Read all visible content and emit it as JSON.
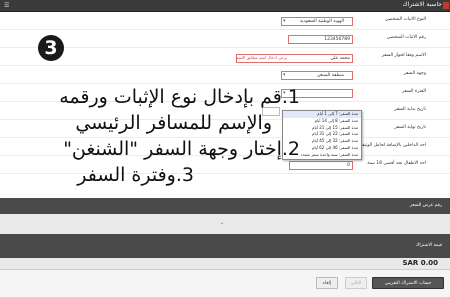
{
  "header": {
    "title": "حاسبة الاشتراك"
  },
  "form": {
    "fields": [
      {
        "label": "النوع الاثبات الشخصي",
        "value": "الهوية الوطنية السعودية"
      },
      {
        "label": "رقم الاثبات الشخصي",
        "value": "123456789"
      },
      {
        "label": "الاسم وفقا لجواز السفر",
        "value": "محمد علي",
        "hint": "يرجي ادخال اسم مطابق الاسم"
      },
      {
        "label": "وجهة السفر",
        "value": "منطقة الشنغن"
      },
      {
        "label": "الفترة السفر",
        "value": ""
      },
      {
        "label": "تاريخ بداية السفر",
        "value": ""
      },
      {
        "label": "تاريخ نهاية السفر",
        "value": ""
      },
      {
        "label": "احد الداخلين بالإضافة لحامل الوثيقة",
        "value": ""
      },
      {
        "label": "احد الاطفال بحد أقصى 18 سنة",
        "value": "0"
      }
    ],
    "period_options": [
      "مدة السفر: 7 إلى 1 أيام",
      "مدة السفر: 8 إلى 14 أيام",
      "مدة السفر: 15 إلى 21 أيام",
      "مدة السفر: 22 إلى 31 أيام",
      "مدة السفر: 32 إلى 45 أيام",
      "مدة السفر: 46 إلى 62 أيام",
      "مدة السفر: سنة واحدة سفر متعدد"
    ]
  },
  "annotation": {
    "step": "3",
    "lines": [
      "1.قم بإدخال نوع الإثبات ورقمه",
      "والإسم للمسافر الرئيسي",
      "2.إختار وجهة السفر \"الشنغن\"",
      "3.وفترة السفر"
    ]
  },
  "sections": {
    "offer_number_title": "رقم عرض السعر",
    "subscription_value_title": "قيمة الاشتراك"
  },
  "price": {
    "value": "SAR 0.00"
  },
  "buttons": {
    "calculate": "حساب الاشتراك التقريبي",
    "next": "التالي",
    "cancel": "إلغاء"
  }
}
